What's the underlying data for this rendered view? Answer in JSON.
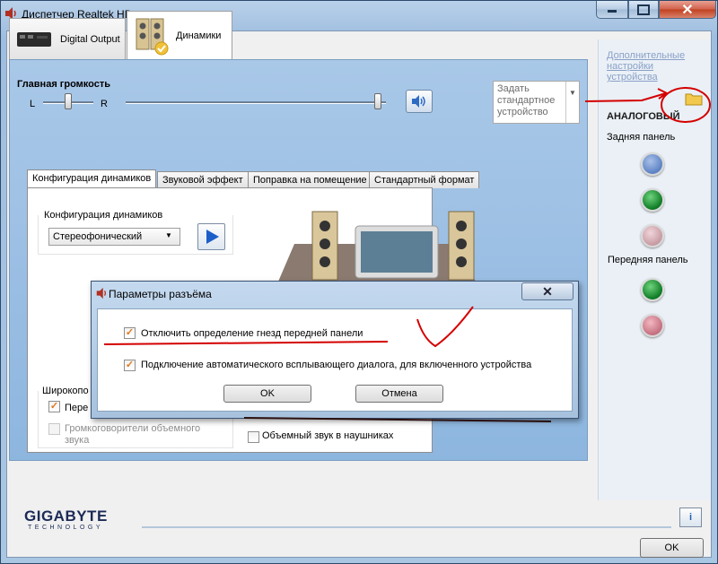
{
  "window": {
    "title": "Диспетчер Realtek HD"
  },
  "device_tabs": [
    {
      "label": "Digital Output",
      "selected": false
    },
    {
      "label": "Динамики",
      "selected": true
    }
  ],
  "volume": {
    "title": "Главная громкость",
    "left_label": "L",
    "right_label": "R",
    "balance": 0.5,
    "level": 0.95
  },
  "set_default": {
    "label": "Задать стандартное устройство"
  },
  "inner_tabs": [
    {
      "label": "Конфигурация динамиков",
      "selected": true
    },
    {
      "label": "Звуковой эффект",
      "selected": false
    },
    {
      "label": "Поправка на помещение",
      "selected": false
    },
    {
      "label": "Стандартный формат",
      "selected": false
    }
  ],
  "speaker_config": {
    "group_label": "Конфигурация динамиков",
    "selected": "Стереофонический"
  },
  "wide_range": {
    "label": "Широкопо",
    "front_label": "Пере",
    "front_checked": true,
    "surround_label": "Громкоговорители объемного звука",
    "surround_checked": false
  },
  "headphone_virtual": {
    "label": "Объемный звук в наушниках",
    "checked": false
  },
  "right_panel": {
    "advanced_link": "Дополнительные настройки устройства",
    "analog_label": "АНАЛОГОВЫЙ",
    "rear_label": "Задняя панель",
    "front_label": "Передняя панель",
    "jack_colors": {
      "blue": "#5c82c4",
      "green": "#0d7a24",
      "pink": "#c79aa3",
      "pink_active": "#c46f7f"
    }
  },
  "brand": {
    "name": "GIGABYTE",
    "sub": "TECHNOLOGY"
  },
  "buttons": {
    "ok": "OK",
    "info": "i"
  },
  "dialog": {
    "title": "Параметры разъёма",
    "option1": "Отключить определение гнезд передней панели",
    "option1_checked": true,
    "option2": "Подключение автоматического всплывающего диалога, для включенного устройства",
    "option2_checked": true,
    "ok": "OK",
    "cancel": "Отмена"
  },
  "accent_colors": {
    "annotation": "#d40000",
    "panel_blue": "#8db6df"
  }
}
